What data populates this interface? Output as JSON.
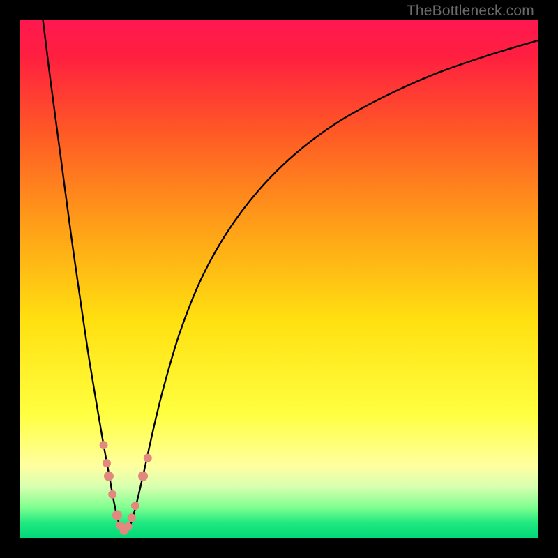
{
  "watermark": {
    "text": "TheBottleneck.com"
  },
  "chart_data": {
    "type": "line",
    "title": "",
    "xlabel": "",
    "ylabel": "",
    "xlim": [
      0,
      100
    ],
    "ylim": [
      0,
      100
    ],
    "grid": false,
    "background_gradient": [
      {
        "stop": 0.0,
        "color": "#ff1850"
      },
      {
        "stop": 0.07,
        "color": "#ff1f40"
      },
      {
        "stop": 0.22,
        "color": "#ff5a25"
      },
      {
        "stop": 0.4,
        "color": "#ffa018"
      },
      {
        "stop": 0.58,
        "color": "#ffe010"
      },
      {
        "stop": 0.76,
        "color": "#ffff40"
      },
      {
        "stop": 0.86,
        "color": "#ffffa0"
      },
      {
        "stop": 0.9,
        "color": "#d8ffb0"
      },
      {
        "stop": 0.94,
        "color": "#80ff90"
      },
      {
        "stop": 0.97,
        "color": "#20e880"
      },
      {
        "stop": 1.0,
        "color": "#00d878"
      }
    ],
    "series": [
      {
        "name": "bottleneck-curve",
        "color": "#000000",
        "x": [
          4.5,
          6,
          8,
          10,
          12,
          13.5,
          15,
          16.2,
          17.3,
          18.2,
          19,
          19.8,
          20.6,
          21.5,
          22.6,
          24,
          26,
          28,
          31,
          35,
          40,
          46,
          53,
          61,
          70,
          80,
          90,
          100
        ],
        "y": [
          100,
          88,
          73,
          58,
          44,
          34,
          25,
          18,
          12,
          7,
          3.5,
          1.5,
          1.5,
          3,
          7,
          13,
          22,
          30,
          40,
          50,
          59,
          67,
          74,
          80,
          85,
          89.5,
          93,
          96
        ]
      }
    ],
    "markers": {
      "name": "highlighted-points",
      "color": "#e3887e",
      "points": [
        {
          "x": 16.2,
          "y": 18.0,
          "r": 6
        },
        {
          "x": 16.8,
          "y": 14.5,
          "r": 6
        },
        {
          "x": 17.2,
          "y": 12.0,
          "r": 7
        },
        {
          "x": 17.9,
          "y": 8.5,
          "r": 6
        },
        {
          "x": 18.8,
          "y": 4.5,
          "r": 7
        },
        {
          "x": 19.4,
          "y": 2.5,
          "r": 6
        },
        {
          "x": 20.1,
          "y": 1.5,
          "r": 6
        },
        {
          "x": 20.9,
          "y": 2.3,
          "r": 6
        },
        {
          "x": 21.6,
          "y": 4.0,
          "r": 6
        },
        {
          "x": 22.3,
          "y": 6.3,
          "r": 6
        },
        {
          "x": 23.8,
          "y": 12.0,
          "r": 7
        },
        {
          "x": 24.7,
          "y": 15.5,
          "r": 6
        }
      ]
    }
  }
}
